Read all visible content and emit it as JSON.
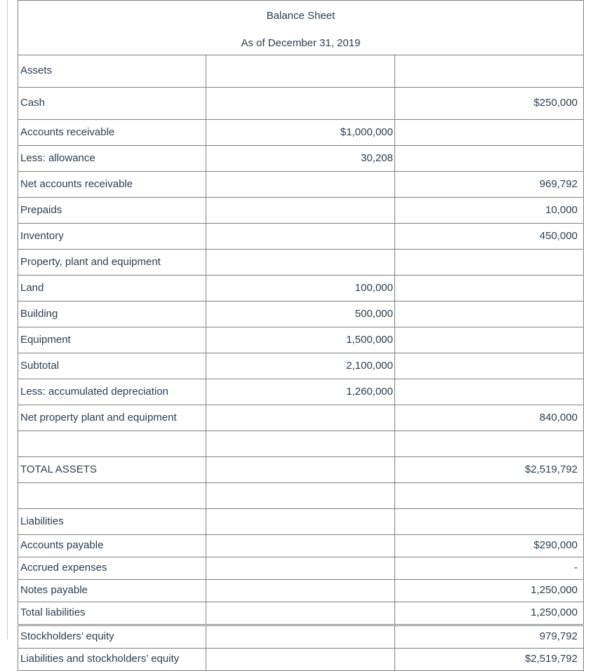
{
  "document": {
    "title": "Balance Sheet",
    "subtitle": "As of December 31, 2019"
  },
  "columns": {
    "label_header": "",
    "detail_header": "",
    "total_header": ""
  },
  "rows": [
    {
      "label": "Assets",
      "detail": "",
      "total": "",
      "height": "tall",
      "type": "section-heading"
    },
    {
      "label": "Cash",
      "detail": "",
      "total": "$250,000",
      "height": "tall",
      "type": "line-item"
    },
    {
      "label": "Accounts receivable",
      "detail": "$1,000,000",
      "total": "",
      "height": "mid",
      "type": "line-item"
    },
    {
      "label": "Less: allowance",
      "detail": "30,208",
      "total": "",
      "height": "mid",
      "type": "line-item"
    },
    {
      "label": "Net accounts receivable",
      "detail": "",
      "total": "969,792",
      "height": "mid",
      "type": "subtotal"
    },
    {
      "label": "Prepaids",
      "detail": "",
      "total": "10,000",
      "height": "mid",
      "type": "line-item"
    },
    {
      "label": "Inventory",
      "detail": "",
      "total": "450,000",
      "height": "mid",
      "type": "line-item"
    },
    {
      "label": "Property, plant and equipment",
      "detail": "",
      "total": "",
      "height": "mid",
      "type": "section-heading"
    },
    {
      "label": "Land",
      "detail": "100,000",
      "total": "",
      "height": "mid",
      "type": "line-item"
    },
    {
      "label": "Building",
      "detail": "500,000",
      "total": "",
      "height": "mid",
      "type": "line-item"
    },
    {
      "label": "Equipment",
      "detail": "1,500,000",
      "total": "",
      "height": "mid",
      "type": "line-item"
    },
    {
      "label": "Subtotal",
      "detail": "2,100,000",
      "total": "",
      "height": "mid",
      "type": "subtotal"
    },
    {
      "label": "Less: accumulated depreciation",
      "detail": "1,260,000",
      "total": "",
      "height": "mid",
      "type": "line-item"
    },
    {
      "label": "Net property plant and equipment",
      "detail": "",
      "total": "840,000",
      "height": "mid",
      "type": "subtotal"
    },
    {
      "label": "",
      "detail": "",
      "total": "",
      "height": "mid",
      "type": "spacer"
    },
    {
      "label": "TOTAL ASSETS",
      "detail": "",
      "total": "$2,519,792",
      "height": "mid",
      "type": "grand-total"
    },
    {
      "label": "",
      "detail": "",
      "total": "",
      "height": "mid",
      "type": "spacer"
    },
    {
      "label": "Liabilities",
      "detail": "",
      "total": "",
      "height": "mid",
      "type": "section-heading"
    },
    {
      "label": "Accounts payable",
      "detail": "",
      "total": "$290,000",
      "height": "short",
      "type": "line-item"
    },
    {
      "label": "Accrued expenses",
      "detail": "",
      "total": "-",
      "height": "short",
      "type": "line-item"
    },
    {
      "label": "Notes payable",
      "detail": "",
      "total": "1,250,000",
      "height": "short",
      "type": "line-item"
    },
    {
      "label": "Total liabilities",
      "detail": "",
      "total": "1,250,000",
      "height": "short",
      "type": "subtotal"
    },
    {
      "label": "Stockholders’ equity",
      "detail": "",
      "total": "979,792",
      "height": "short",
      "type": "line-item",
      "separator_above": true
    },
    {
      "label": "Liabilities and stockholders’ equity",
      "detail": "",
      "total": "$2,519,792",
      "height": "short",
      "type": "grand-total"
    }
  ],
  "style": {
    "border_color": "#808080",
    "text_color": "#2f3e4d",
    "background": "#ffffff"
  }
}
